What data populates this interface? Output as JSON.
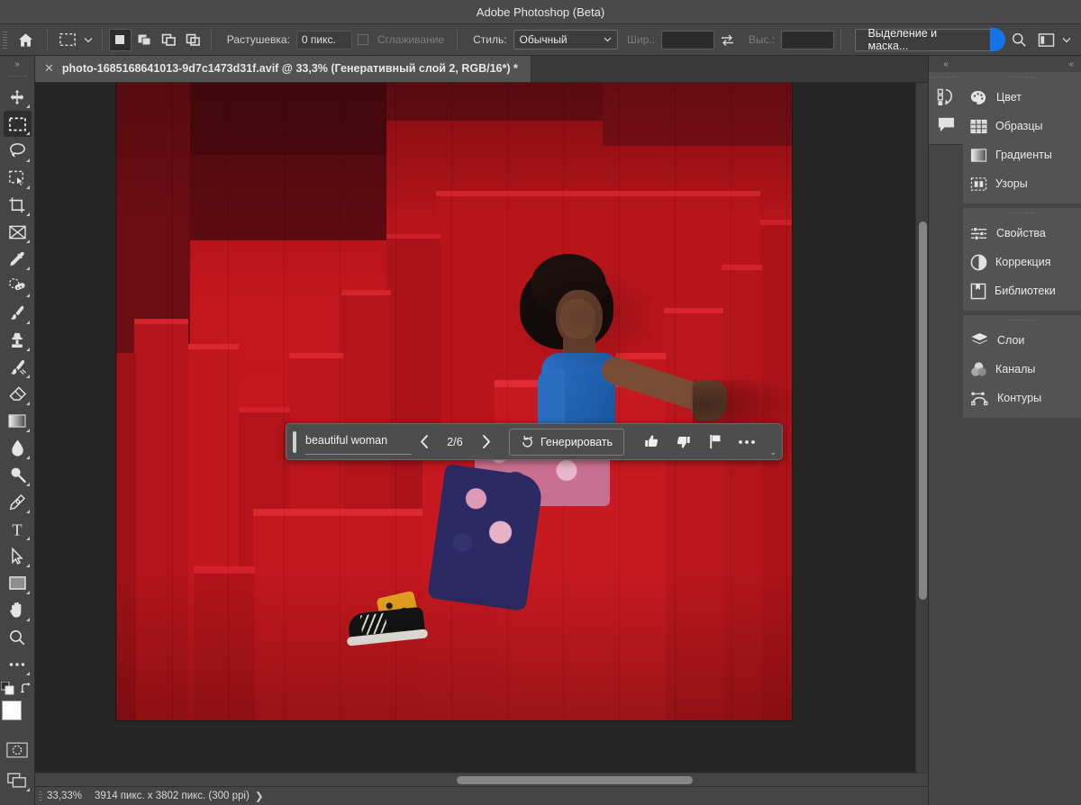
{
  "window": {
    "title": "Adobe Photoshop (Beta)"
  },
  "options_bar": {
    "home_icon": "home-icon",
    "tool_preset_icon": "rectangular-marquee-icon",
    "tool_preset_caret": "chevron-down-icon",
    "selection_modes": [
      {
        "name": "new-selection",
        "icon": "square-filled-icon",
        "active": true
      },
      {
        "name": "add-to-selection",
        "icon": "two-squares-union-icon",
        "active": false
      },
      {
        "name": "subtract-from-selection",
        "icon": "two-squares-subtract-icon",
        "active": false
      },
      {
        "name": "intersect-selection",
        "icon": "two-squares-intersect-icon",
        "active": false
      }
    ],
    "feather_label": "Растушевка:",
    "feather_value": "0 пикс.",
    "antialias_label": "Сглаживание",
    "antialias_checked": false,
    "style_label": "Стиль:",
    "style_value": "Обычный",
    "width_label": "Шир.:",
    "width_value": "",
    "swap_icon": "swap-arrows-icon",
    "height_label": "Выс.:",
    "height_value": "",
    "select_and_mask_label": "Выделение и маска...",
    "search_icon": "search-icon",
    "workspace_icon": "workspace-layout-icon",
    "workspace_caret": "chevron-down-icon"
  },
  "toolbar": {
    "collapse_icon": "double-chevron-right-icon",
    "tools": [
      {
        "name": "move-tool",
        "icon": "move-icon",
        "active": false
      },
      {
        "name": "rectangular-marquee-tool",
        "icon": "marquee-icon",
        "active": true
      },
      {
        "name": "lasso-tool",
        "icon": "lasso-icon",
        "active": false
      },
      {
        "name": "object-selection-tool",
        "icon": "object-select-icon",
        "active": false
      },
      {
        "name": "crop-tool",
        "icon": "crop-icon",
        "active": false
      },
      {
        "name": "frame-tool",
        "icon": "frame-icon",
        "active": false
      },
      {
        "name": "eyedropper-tool",
        "icon": "eyedropper-icon",
        "active": false
      },
      {
        "name": "spot-healing-brush-tool",
        "icon": "healing-brush-icon",
        "active": false
      },
      {
        "name": "brush-tool",
        "icon": "brush-icon",
        "active": false
      },
      {
        "name": "clone-stamp-tool",
        "icon": "clone-stamp-icon",
        "active": false
      },
      {
        "name": "history-brush-tool",
        "icon": "history-brush-icon",
        "active": false
      },
      {
        "name": "eraser-tool",
        "icon": "eraser-icon",
        "active": false
      },
      {
        "name": "gradient-tool",
        "icon": "gradient-icon",
        "active": false
      },
      {
        "name": "blur-tool",
        "icon": "blur-drop-icon",
        "active": false
      },
      {
        "name": "dodge-tool",
        "icon": "dodge-icon",
        "active": false
      },
      {
        "name": "pen-tool",
        "icon": "pen-icon",
        "active": false
      },
      {
        "name": "type-tool",
        "icon": "type-T-icon",
        "active": false
      },
      {
        "name": "path-selection-tool",
        "icon": "path-arrow-icon",
        "active": false
      },
      {
        "name": "rectangle-tool",
        "icon": "rectangle-icon",
        "active": false
      },
      {
        "name": "hand-tool",
        "icon": "hand-icon",
        "active": false
      },
      {
        "name": "zoom-tool",
        "icon": "magnifier-icon",
        "active": false
      },
      {
        "name": "edit-toolbar",
        "icon": "ellipsis-icon",
        "active": false
      }
    ],
    "foreground_color": "#ffffff",
    "background_color": "#ffffff",
    "swap_colors_icon": "swap-colors-icon",
    "quick_mask_icon": "quick-mask-icon",
    "screen_mode_icon": "screen-mode-icon"
  },
  "document": {
    "tab_close_icon": "close-icon",
    "tab_title": "photo-1685168641013-9d7c1473d31f.avif @ 33,3% (Генеративный слой 2, RGB/16*) *"
  },
  "status_bar": {
    "zoom": "33,33%",
    "dimensions": "3914 пикс. x 3802 пикс. (300 ppi)",
    "expand_icon": "chevron-right-icon"
  },
  "generative_bar": {
    "drag_handle": "drag-handle",
    "prompt_value": "beautiful woman",
    "prompt_placeholder": "beautiful woman",
    "prev_icon": "chevron-left-icon",
    "variation_count": "2/6",
    "next_icon": "chevron-right-icon",
    "generate_icon": "sparkle-refresh-icon",
    "generate_label": "Генерировать",
    "thumbs_up_icon": "thumbs-up-icon",
    "thumbs_down_icon": "thumbs-down-icon",
    "report_icon": "flag-icon",
    "more_icon": "ellipsis-icon",
    "resize_caret": "chevron-down-icon"
  },
  "right_rail": {
    "collapse_icon": "double-chevron-left-icon",
    "items": [
      {
        "name": "history-panel-icon",
        "icon": "history-icon"
      },
      {
        "name": "comments-panel-icon",
        "icon": "comment-bubble-icon"
      }
    ]
  },
  "dock": {
    "collapse_icon": "double-chevron-left-icon",
    "groups": [
      {
        "items": [
          {
            "label": "Цвет",
            "icon": "color-palette-icon",
            "name": "panel-color"
          },
          {
            "label": "Образцы",
            "icon": "swatches-grid-icon",
            "name": "panel-swatches"
          },
          {
            "label": "Градиенты",
            "icon": "gradient-square-icon",
            "name": "panel-gradients"
          },
          {
            "label": "Узоры",
            "icon": "pattern-icon",
            "name": "panel-patterns"
          }
        ]
      },
      {
        "items": [
          {
            "label": "Свойства",
            "icon": "sliders-icon",
            "name": "panel-properties"
          },
          {
            "label": "Коррекция",
            "icon": "half-circle-icon",
            "name": "panel-adjustments"
          },
          {
            "label": "Библиотеки",
            "icon": "library-book-icon",
            "name": "panel-libraries"
          }
        ]
      },
      {
        "items": [
          {
            "label": "Слои",
            "icon": "layers-stack-icon",
            "name": "panel-layers"
          },
          {
            "label": "Каналы",
            "icon": "channels-venn-icon",
            "name": "panel-channels"
          },
          {
            "label": "Контуры",
            "icon": "paths-curve-icon",
            "name": "panel-paths"
          }
        ]
      }
    ]
  },
  "colors": {
    "accent_blue": "#1473e6",
    "chrome_bg": "#454545",
    "canvas_bg": "#262626",
    "photo_red": "#c0161c",
    "photo_red_dark": "#7e0c12",
    "top_dark": "#5e0c12",
    "shirt_blue": "#1f63b8",
    "sock_orange": "#e8a321",
    "pants_purple": "#2d2a66"
  }
}
